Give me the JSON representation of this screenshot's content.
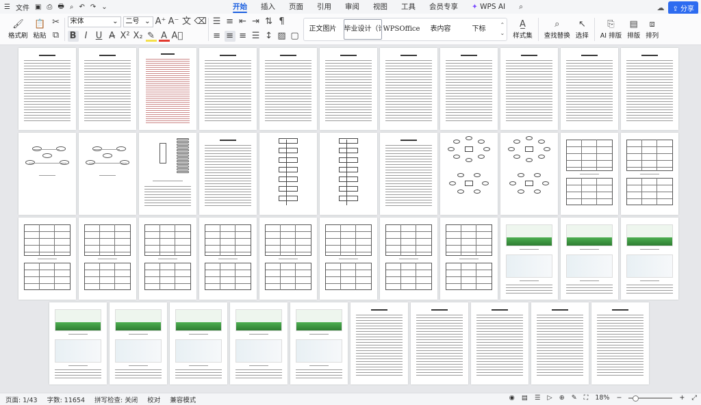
{
  "titlebar": {
    "file_menu": "文件",
    "tabs": [
      "开始",
      "插入",
      "页面",
      "引用",
      "审阅",
      "视图",
      "工具",
      "会员专享"
    ],
    "active_tab": "开始",
    "wps_ai": "WPS AI",
    "share": "分享"
  },
  "ribbon": {
    "format_painter": "格式刷",
    "paste": "粘贴",
    "font_name": "宋体",
    "font_size": "二号",
    "styles": [
      "正文图片",
      "毕业设计（论",
      "WPSOffice 手",
      "表内容",
      "下标"
    ],
    "style_set": "样式集",
    "find_replace": "查找替换",
    "select": "选择",
    "ai_layout": "AI 排版",
    "layout": "排版",
    "arrange": "排列"
  },
  "status": {
    "page": "页面: 1/43",
    "words": "字数: 11654",
    "spell": "拼写检查: 关闭",
    "proof": "校对",
    "mode": "兼容模式",
    "zoom": "18%"
  },
  "pages": [
    {
      "k": "t"
    },
    {
      "k": "t"
    },
    {
      "k": "toc"
    },
    {
      "k": "t"
    },
    {
      "k": "t"
    },
    {
      "k": "t"
    },
    {
      "k": "t"
    },
    {
      "k": "t"
    },
    {
      "k": "t"
    },
    {
      "k": "t"
    },
    {
      "k": "t"
    },
    {
      "k": "er"
    },
    {
      "k": "er"
    },
    {
      "k": "tree"
    },
    {
      "k": "t"
    },
    {
      "k": "flow"
    },
    {
      "k": "flow2"
    },
    {
      "k": "t"
    },
    {
      "k": "radial"
    },
    {
      "k": "radial"
    },
    {
      "k": "tbl"
    },
    {
      "k": "tbl"
    },
    {
      "k": "tbl"
    },
    {
      "k": "tbl"
    },
    {
      "k": "tbl"
    },
    {
      "k": "tbl"
    },
    {
      "k": "tbl"
    },
    {
      "k": "tbl"
    },
    {
      "k": "tbl"
    },
    {
      "k": "tbl"
    },
    {
      "k": "shot"
    },
    {
      "k": "shot"
    },
    {
      "k": "shot"
    },
    {
      "k": "shot"
    },
    {
      "k": "shot"
    },
    {
      "k": "shot"
    },
    {
      "k": "shot"
    },
    {
      "k": "shot"
    },
    {
      "k": "t"
    },
    {
      "k": "t"
    },
    {
      "k": "t"
    },
    {
      "k": "t"
    },
    {
      "k": "t"
    }
  ]
}
